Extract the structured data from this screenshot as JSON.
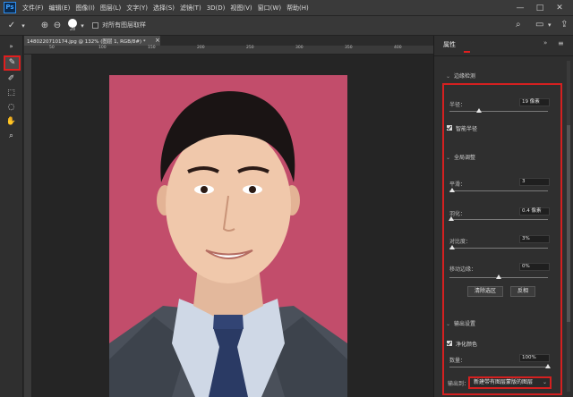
{
  "app": {
    "logo": "Ps"
  },
  "menu": [
    "文件(F)",
    "编辑(E)",
    "图像(I)",
    "图层(L)",
    "文字(Y)",
    "选择(S)",
    "滤镜(T)",
    "3D(D)",
    "视图(V)",
    "窗口(W)",
    "帮助(H)"
  ],
  "window_controls": {
    "minimize": "—",
    "maximize": "□",
    "close": "✕"
  },
  "options_bar": {
    "brush_size": "28",
    "sample_all_layers_label": "对所有图层取样",
    "sample_all_layers_checked": false
  },
  "document": {
    "tab_title": "14802207101​74.jpg @ 132% (图层 1, RGB/8#) *",
    "close": "×"
  },
  "rulers": {
    "top_ticks": [
      "50",
      "100",
      "150",
      "200",
      "250",
      "300",
      "350",
      "400"
    ]
  },
  "panel": {
    "title": "属性",
    "edge_detection": {
      "heading": "边缘检测",
      "radius_label": "半径：",
      "radius_value": "19 像素",
      "radius_fraction": 0.3,
      "smart_radius_label": "智能半径",
      "smart_radius_checked": true
    },
    "global_refine": {
      "heading": "全局调整",
      "smooth_label": "平滑：",
      "smooth_value": "3",
      "smooth_fraction": 0.03,
      "feather_label": "羽化：",
      "feather_value": "0.4 像素",
      "feather_fraction": 0.02,
      "contrast_label": "对比度：",
      "contrast_value": "3%",
      "contrast_fraction": 0.03,
      "shift_edge_label": "移动边缘：",
      "shift_edge_value": "0%",
      "shift_edge_fraction": 0.5,
      "clear_selection_label": "清除选区",
      "invert_label": "反相"
    },
    "output": {
      "heading": "输出设置",
      "decontaminate_label": "净化颜色",
      "decontaminate_checked": true,
      "amount_label": "数量：",
      "amount_value": "100%",
      "amount_fraction": 1.0,
      "output_to_label": "输出到：",
      "output_to_value": "新建带有图层蒙版的图层"
    }
  },
  "colors": {
    "background_pink": "#c24d6b",
    "highlight_red": "#d42020"
  }
}
